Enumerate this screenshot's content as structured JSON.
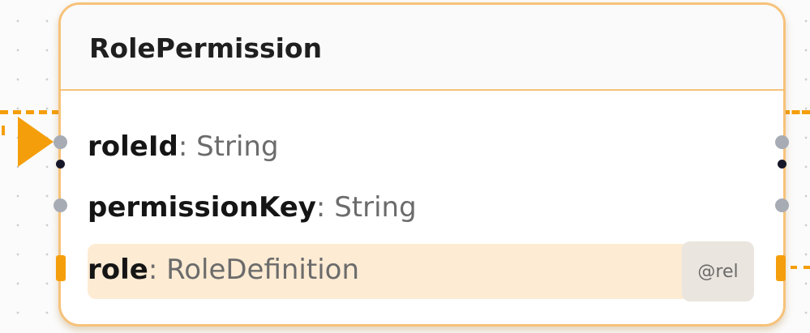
{
  "node": {
    "title": "RolePermission",
    "fields": [
      {
        "name": "roleId",
        "separator": ": ",
        "type": "String"
      },
      {
        "name": "permissionKey",
        "separator": ": ",
        "type": "String"
      },
      {
        "name": "role",
        "separator": ": ",
        "type": "RoleDefinition",
        "badge": "@rel"
      }
    ]
  },
  "colors": {
    "accent": "#f59e0b",
    "border": "#f6c27a",
    "relation_row": "#fdebd3",
    "handle": "#a7abb4"
  }
}
